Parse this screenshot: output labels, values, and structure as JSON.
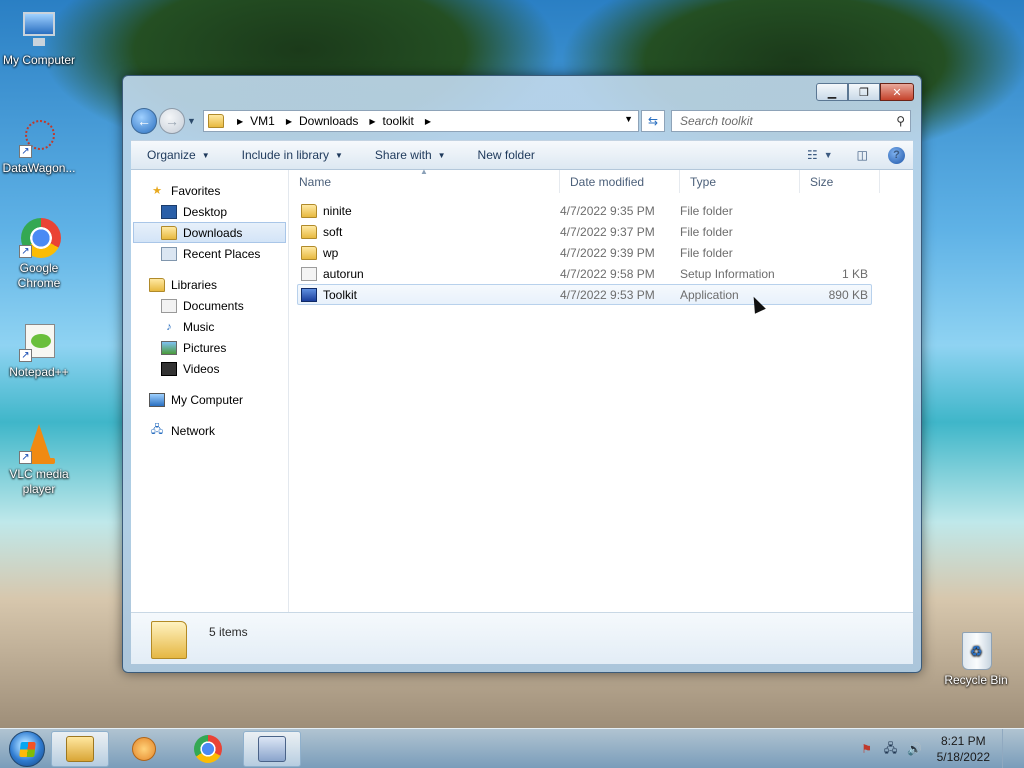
{
  "desktop": {
    "icons": [
      {
        "label": "My Computer"
      },
      {
        "label": "DataWagon..."
      },
      {
        "label": "Google Chrome"
      },
      {
        "label": "Notepad++"
      },
      {
        "label": "VLC media player"
      }
    ],
    "recycle_bin": "Recycle Bin"
  },
  "window": {
    "breadcrumb": [
      "VM1",
      "Downloads",
      "toolkit"
    ],
    "search_placeholder": "Search toolkit",
    "toolbar": {
      "organize": "Organize",
      "include_in_library": "Include in library",
      "share_with": "Share with",
      "new_folder": "New folder"
    },
    "navpane": {
      "favorites": "Favorites",
      "favorites_items": [
        "Desktop",
        "Downloads",
        "Recent Places"
      ],
      "libraries": "Libraries",
      "libraries_items": [
        "Documents",
        "Music",
        "Pictures",
        "Videos"
      ],
      "my_computer": "My Computer",
      "network": "Network"
    },
    "columns": {
      "name": "Name",
      "date": "Date modified",
      "type": "Type",
      "size": "Size"
    },
    "files": [
      {
        "name": "ninite",
        "date": "4/7/2022 9:35 PM",
        "type": "File folder",
        "size": "",
        "icon": "folder-icon"
      },
      {
        "name": "soft",
        "date": "4/7/2022 9:37 PM",
        "type": "File folder",
        "size": "",
        "icon": "folder-icon"
      },
      {
        "name": "wp",
        "date": "4/7/2022 9:39 PM",
        "type": "File folder",
        "size": "",
        "icon": "folder-icon"
      },
      {
        "name": "autorun",
        "date": "4/7/2022 9:58 PM",
        "type": "Setup Information",
        "size": "1 KB",
        "icon": "setup-info-icon"
      },
      {
        "name": "Toolkit",
        "date": "4/7/2022 9:53 PM",
        "type": "Application",
        "size": "890 KB",
        "icon": "application-icon"
      }
    ],
    "status": "5 items"
  },
  "taskbar": {
    "time": "8:21 PM",
    "date": "5/18/2022"
  }
}
